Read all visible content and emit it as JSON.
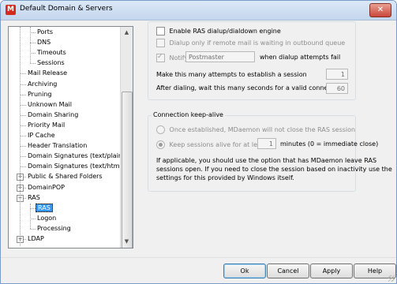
{
  "window": {
    "title": "Default Domain & Servers",
    "close_glyph": "✕",
    "app_icon_glyph": "M"
  },
  "tree": {
    "items": [
      {
        "label": "Ports",
        "level": 2
      },
      {
        "label": "DNS",
        "level": 2
      },
      {
        "label": "Timeouts",
        "level": 2
      },
      {
        "label": "Sessions",
        "level": 2
      },
      {
        "label": "Mail Release",
        "level": 1
      },
      {
        "label": "Archiving",
        "level": 1
      },
      {
        "label": "Pruning",
        "level": 1
      },
      {
        "label": "Unknown Mail",
        "level": 1
      },
      {
        "label": "Domain Sharing",
        "level": 1
      },
      {
        "label": "Priority Mail",
        "level": 1
      },
      {
        "label": "IP Cache",
        "level": 1
      },
      {
        "label": "Header Translation",
        "level": 1
      },
      {
        "label": "Domain Signatures (text/plain)",
        "level": 1
      },
      {
        "label": "Domain Signatures (text/html)",
        "level": 1
      },
      {
        "label": "Public & Shared Folders",
        "level": 1,
        "expander": "+"
      },
      {
        "label": "DomainPOP",
        "level": 1,
        "expander": "+"
      },
      {
        "label": "RAS",
        "level": 1,
        "expander": "−"
      },
      {
        "label": "RAS",
        "level": 2,
        "selected": true
      },
      {
        "label": "Logon",
        "level": 2
      },
      {
        "label": "Processing",
        "level": 2
      },
      {
        "label": "LDAP",
        "level": 1,
        "expander": "+"
      }
    ],
    "scroll_up": "▲",
    "scroll_down": "▼"
  },
  "ras": {
    "enable_label": "Enable RAS dialup/dialdown engine",
    "dialup_only_label": "Dialup only if remote mail is waiting in outbound queue",
    "notify_label": "Notify",
    "notify_value": "Postmaster",
    "notify_suffix": "when dialup attempts fail",
    "attempts_label": "Make this many attempts to establish a session",
    "attempts_value": "1",
    "wait_label": "After dialing, wait this many seconds for a valid connection",
    "wait_value": "60"
  },
  "keepalive": {
    "title": "Connection keep-alive",
    "option1": "Once established, MDaemon will not close the RAS session",
    "option2_prefix": "Keep sessions alive for at least",
    "option2_value": "1",
    "option2_suffix": "minutes (0 = immediate close)",
    "help_text_1": "If applicable, you should use the option that has MDaemon leave RAS",
    "help_text_2": "sessions open.  If you need to close the session based on inactivity use the",
    "help_text_3": "settings for this provided by Windows itself."
  },
  "buttons": {
    "ok": "Ok",
    "cancel": "Cancel",
    "apply": "Apply",
    "help": "Help"
  }
}
